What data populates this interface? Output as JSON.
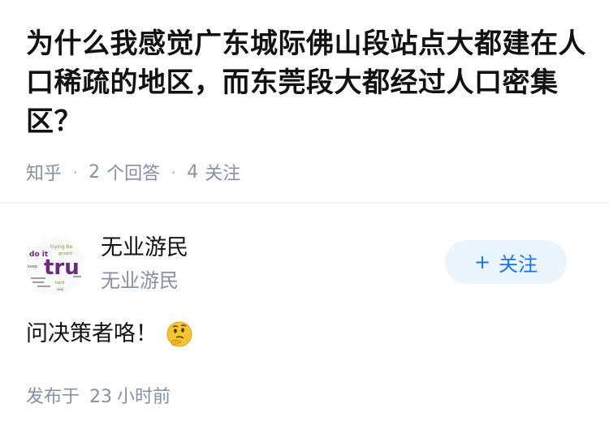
{
  "question": {
    "title": "为什么我感觉广东城际佛山段站点大都建在人口稀疏的地区，而东莞段大都经过人口密集区？"
  },
  "meta": {
    "source": "知乎",
    "answers_count": "2",
    "answers_label": "个回答",
    "followers_count": "4",
    "followers_label": "关注"
  },
  "author": {
    "name": "无业游民",
    "subtitle": "无业游民",
    "avatar_words": [
      "trying be",
      "growth",
      "do it",
      "tru",
      "keep",
      "hard",
      "soul"
    ],
    "follow_plus": "+",
    "follow_label": "关注"
  },
  "answer": {
    "text": "问决策者咯！",
    "emoji": "thinking-face-icon"
  },
  "timestamp": {
    "prefix": "发布于",
    "value": "23",
    "unit": "小时前"
  },
  "colors": {
    "text": "#121212",
    "muted": "#8590a6",
    "accent": "#1772f6",
    "follow_bg": "#ebf5fd",
    "avatar_purple": "#6b2a7a",
    "avatar_green": "#7a9a2a"
  }
}
